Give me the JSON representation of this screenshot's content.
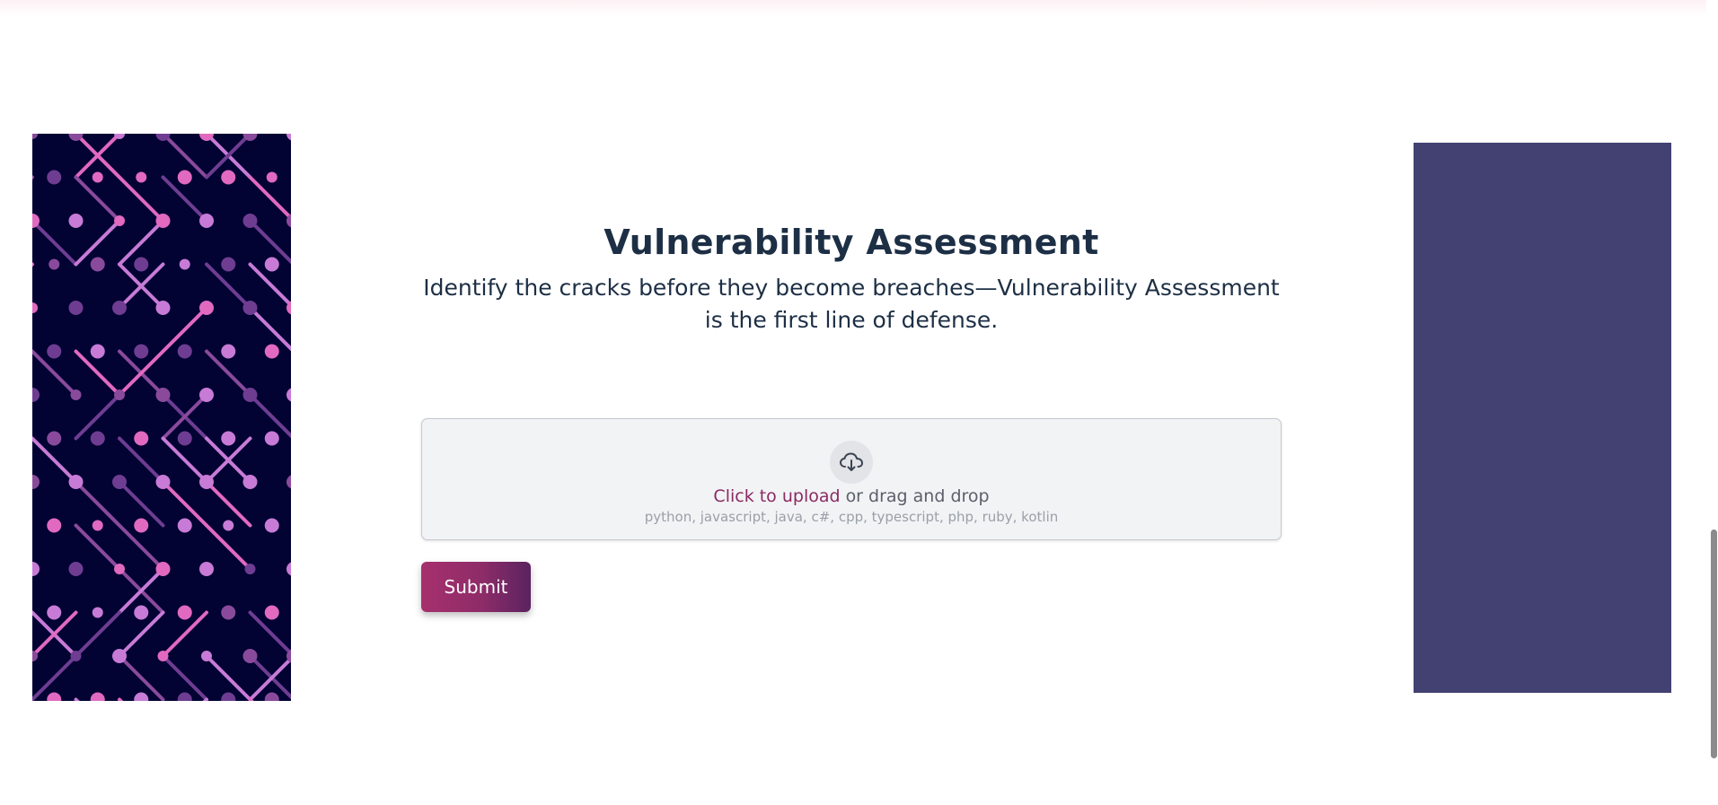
{
  "header": {
    "title": "Vulnerability Assessment",
    "subtitle": "Identify the cracks before they become breaches—Vulnerability Assessment is the first line of defense."
  },
  "upload": {
    "icon": "cloud-download-icon",
    "link_label": "Click to upload",
    "rest_label": "or drag and drop",
    "formats": "python, javascript, java, c#, cpp, typescript, php, ruby, kotlin"
  },
  "actions": {
    "submit_label": "Submit"
  },
  "colors": {
    "heading": "#1d2f45",
    "accent": "#8a2a63",
    "left_panel_bg": "#020233",
    "right_panel_bg": "#424171",
    "pattern_colors": [
      "#6e3d92",
      "#c77bd6",
      "#e169c0",
      "#8a4a9c"
    ]
  }
}
